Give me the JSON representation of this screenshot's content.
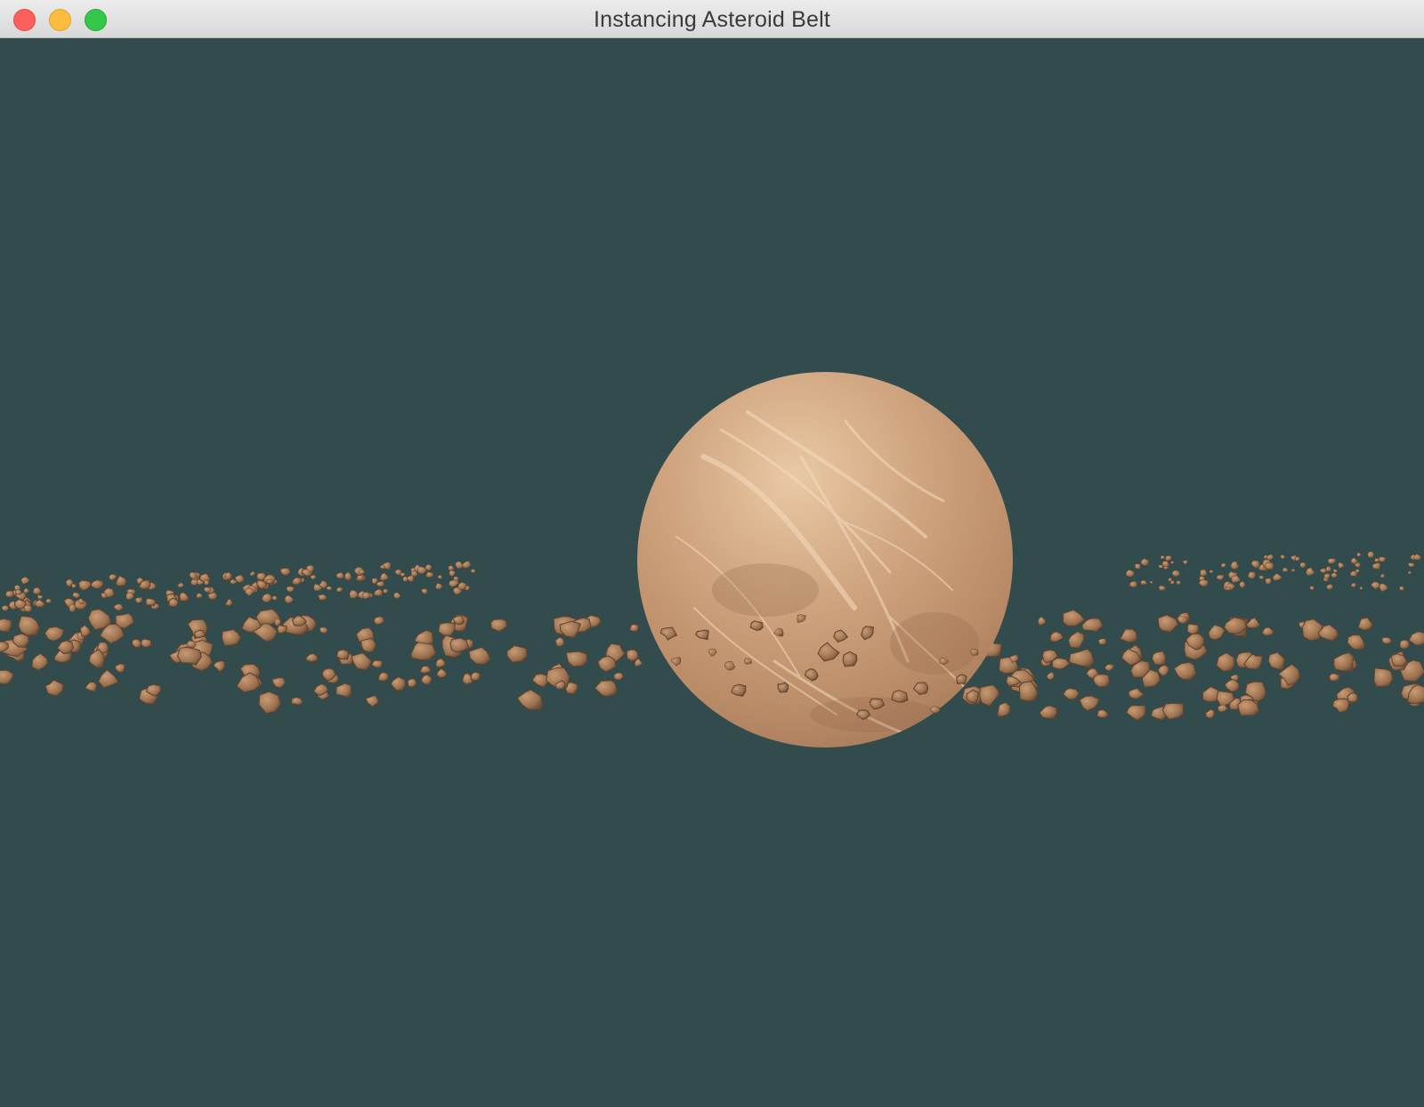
{
  "window": {
    "title": "Instancing Asteroid Belt",
    "traffic_lights": {
      "close": "close-icon",
      "minimize": "minimize-icon",
      "zoom": "zoom-icon"
    }
  },
  "scene": {
    "background_color": "#324b4c",
    "planet_color": "#c9a07b",
    "asteroid_color": "#a57a56"
  }
}
